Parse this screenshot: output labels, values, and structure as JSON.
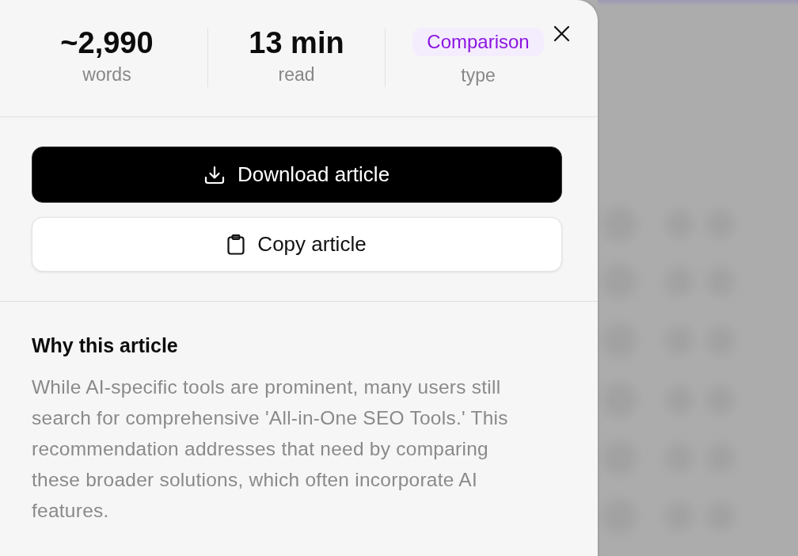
{
  "stats": [
    {
      "kind": "number",
      "value": "~2,990",
      "label": "words"
    },
    {
      "kind": "number",
      "value": "13 min",
      "label": "read"
    },
    {
      "kind": "badge",
      "value": "Comparison",
      "label": "type"
    }
  ],
  "actions": [
    {
      "kind": "primary",
      "label": "Download article"
    },
    {
      "kind": "secondary",
      "label": "Copy article"
    }
  ],
  "section": {
    "heading": "Why this article",
    "body": "While AI-specific tools are prominent, many users still search for comprehensive 'All-in-One SEO Tools.' This recommendation addresses that need by comparing these broader solutions, which often incorporate AI features."
  }
}
